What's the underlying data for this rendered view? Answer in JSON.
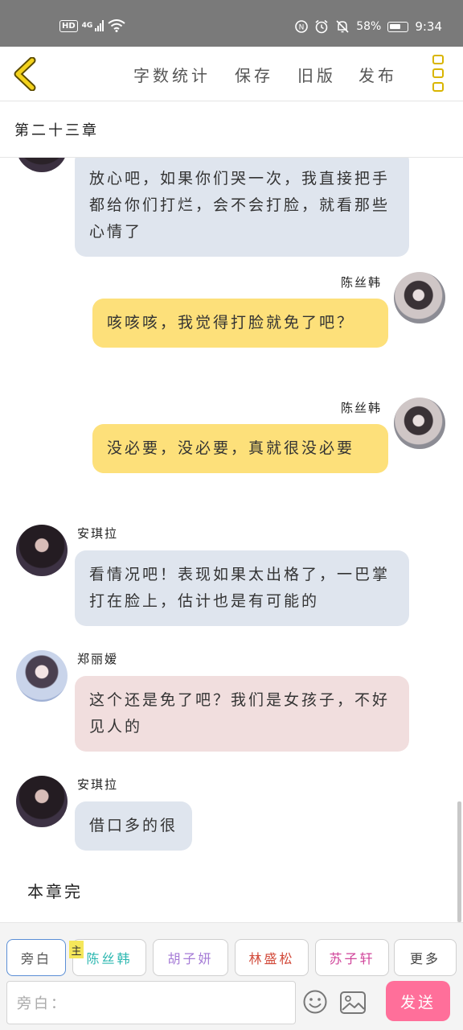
{
  "status": {
    "hd": "HD",
    "network": "4G",
    "battery": "58%",
    "time": "9:34"
  },
  "toolbar": {
    "word_count": "字数统计",
    "save": "保存",
    "old_version": "旧版",
    "publish": "发布"
  },
  "chapter": {
    "title": "第二十三章"
  },
  "messages": [
    {
      "speaker": "",
      "side": "left",
      "text": "放心吧，如果你们哭一次，我直接把手都给你们打烂，会不会打脸，就看那些心情了"
    },
    {
      "speaker": "陈丝韩",
      "side": "right",
      "text": "咳咳咳，我觉得打脸就免了吧？"
    },
    {
      "speaker": "陈丝韩",
      "side": "right",
      "text": "没必要，没必要，真就很没必要"
    },
    {
      "speaker": "安琪拉",
      "side": "left",
      "text": "看情况吧！表现如果太出格了，一巴掌打在脸上，估计也是有可能的"
    },
    {
      "speaker": "郑丽嫒",
      "side": "left",
      "text": "这个还是免了吧？我们是女孩子，不好见人的"
    },
    {
      "speaker": "安琪拉",
      "side": "left",
      "text": "借口多的很"
    }
  ],
  "end_text": "本章完",
  "characters": {
    "narrator": "旁白",
    "main_tag": "主",
    "c1": "陈丝韩",
    "c2": "胡子妍",
    "c3": "林盛松",
    "c4": "苏子轩",
    "more": "更多"
  },
  "input": {
    "placeholder": "旁白："
  },
  "send": "发送",
  "colors": {
    "accent_yellow": "#fde07a",
    "bubble_grey": "#dfe5ee",
    "bubble_pink": "#f1dede",
    "send_pink": "#ff6f9a",
    "c1_color": "#2bb7b0",
    "c2_color": "#a57bd6",
    "c3_color": "#d24a3a",
    "c4_color": "#d0449a"
  }
}
